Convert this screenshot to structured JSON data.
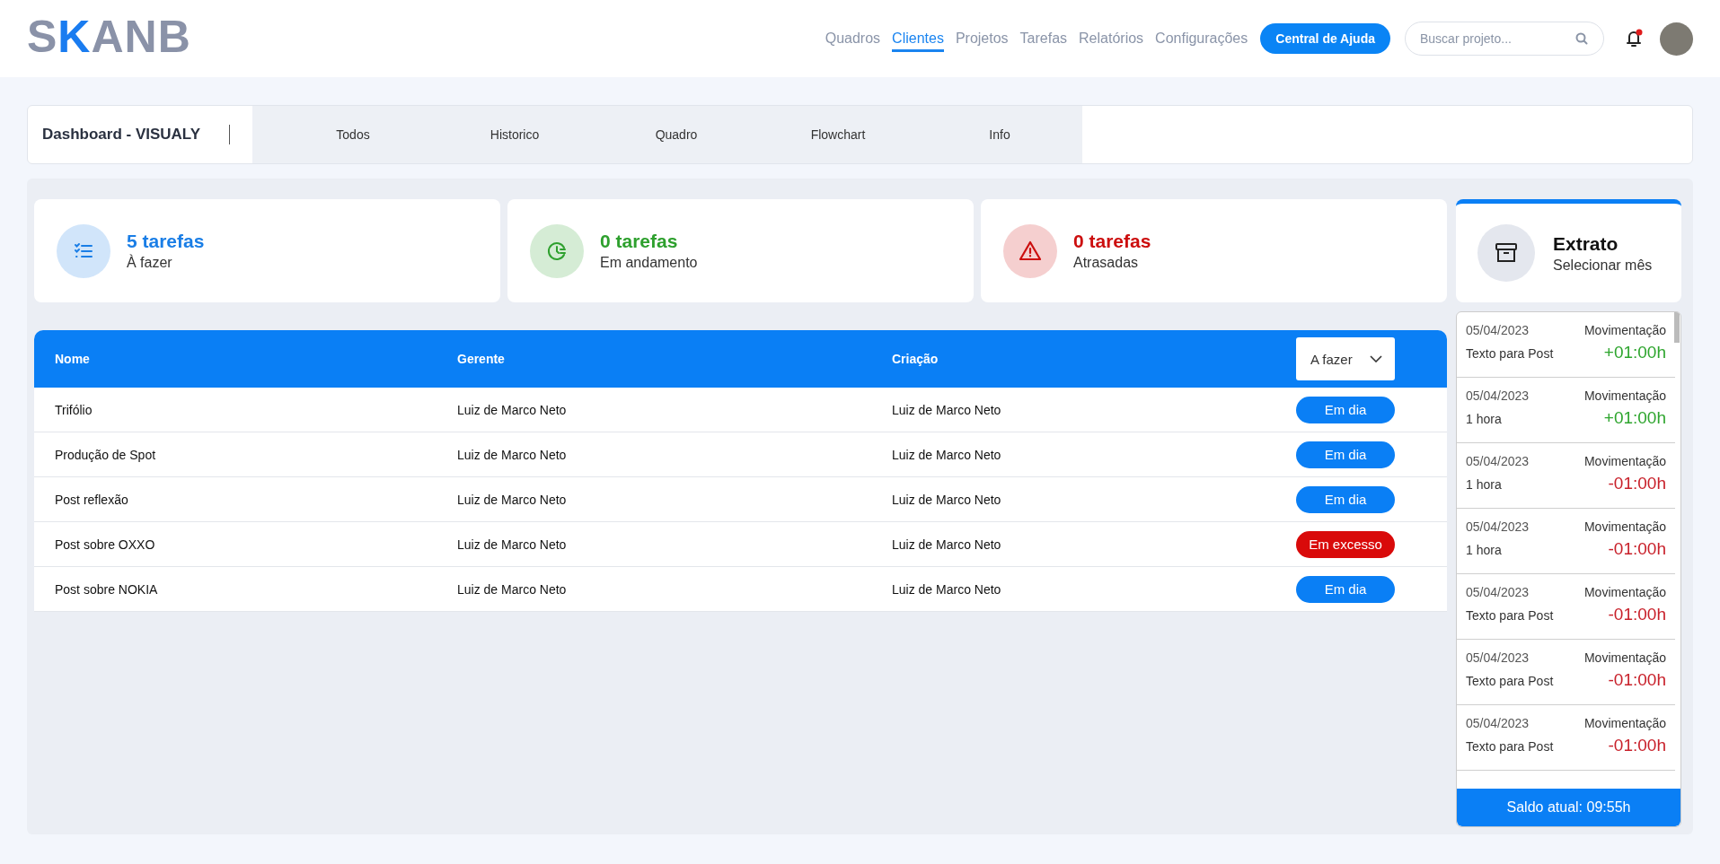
{
  "logo": {
    "prefix": "S",
    "accent": "K",
    "suffix": "ANB"
  },
  "nav": [
    {
      "label": "Quadros",
      "selected": false
    },
    {
      "label": "Clientes",
      "selected": true
    },
    {
      "label": "Projetos",
      "selected": false
    },
    {
      "label": "Tarefas",
      "selected": false
    },
    {
      "label": "Relatórios",
      "selected": false
    },
    {
      "label": "Configurações",
      "selected": false
    }
  ],
  "help_button": "Central de Ajuda",
  "search": {
    "placeholder": "Buscar projeto..."
  },
  "notifications": {
    "unread": true
  },
  "page_title": "Dashboard - VISUALY",
  "subtabs": [
    "Todos",
    "Historico",
    "Quadro",
    "Flowchart",
    "Info"
  ],
  "stats": [
    {
      "kind": "todo",
      "count": "5 tarefas",
      "label": "À fazer",
      "color": "#1a7ee6"
    },
    {
      "kind": "progress",
      "count": "0 tarefas",
      "label": "Em andamento",
      "color": "#2ea02e"
    },
    {
      "kind": "late",
      "count": "0 tarefas",
      "label": "Atrasadas",
      "color": "#cc0e0e"
    }
  ],
  "table": {
    "columns": [
      "Nome",
      "Gerente",
      "Criação"
    ],
    "filter": "A fazer",
    "rows": [
      {
        "name": "Trifólio",
        "manager": "Luiz de Marco Neto",
        "creator": "Luiz de Marco Neto",
        "status": {
          "label": "Em dia",
          "kind": "ok"
        }
      },
      {
        "name": "Produção de Spot",
        "manager": "Luiz de Marco Neto",
        "creator": "Luiz de Marco Neto",
        "status": {
          "label": "Em dia",
          "kind": "ok"
        }
      },
      {
        "name": "Post reflexão",
        "manager": "Luiz de Marco Neto",
        "creator": "Luiz de Marco Neto",
        "status": {
          "label": "Em dia",
          "kind": "ok"
        }
      },
      {
        "name": "Post sobre OXXO",
        "manager": "Luiz de Marco Neto",
        "creator": "Luiz de Marco Neto",
        "status": {
          "label": "Em excesso",
          "kind": "excess"
        }
      },
      {
        "name": "Post sobre NOKIA",
        "manager": "Luiz de Marco Neto",
        "creator": "Luiz de Marco Neto",
        "status": {
          "label": "Em dia",
          "kind": "ok"
        }
      }
    ]
  },
  "statement": {
    "title": "Extrato",
    "subtitle": "Selecionar mês",
    "entries": [
      {
        "date": "05/04/2023",
        "type": "Movimentação",
        "description": "Texto para Post",
        "amount": "+01:00h",
        "kind": "credit"
      },
      {
        "date": "05/04/2023",
        "type": "Movimentação",
        "description": "1 hora",
        "amount": "+01:00h",
        "kind": "credit"
      },
      {
        "date": "05/04/2023",
        "type": "Movimentação",
        "description": "1 hora",
        "amount": "-01:00h",
        "kind": "debit"
      },
      {
        "date": "05/04/2023",
        "type": "Movimentação",
        "description": "1 hora",
        "amount": "-01:00h",
        "kind": "debit"
      },
      {
        "date": "05/04/2023",
        "type": "Movimentação",
        "description": "Texto para Post",
        "amount": "-01:00h",
        "kind": "debit"
      },
      {
        "date": "05/04/2023",
        "type": "Movimentação",
        "description": "Texto para Post",
        "amount": "-01:00h",
        "kind": "debit"
      },
      {
        "date": "05/04/2023",
        "type": "Movimentação",
        "description": "Texto para Post",
        "amount": "-01:00h",
        "kind": "debit"
      }
    ],
    "balance": "Saldo atual: 09:55h"
  }
}
